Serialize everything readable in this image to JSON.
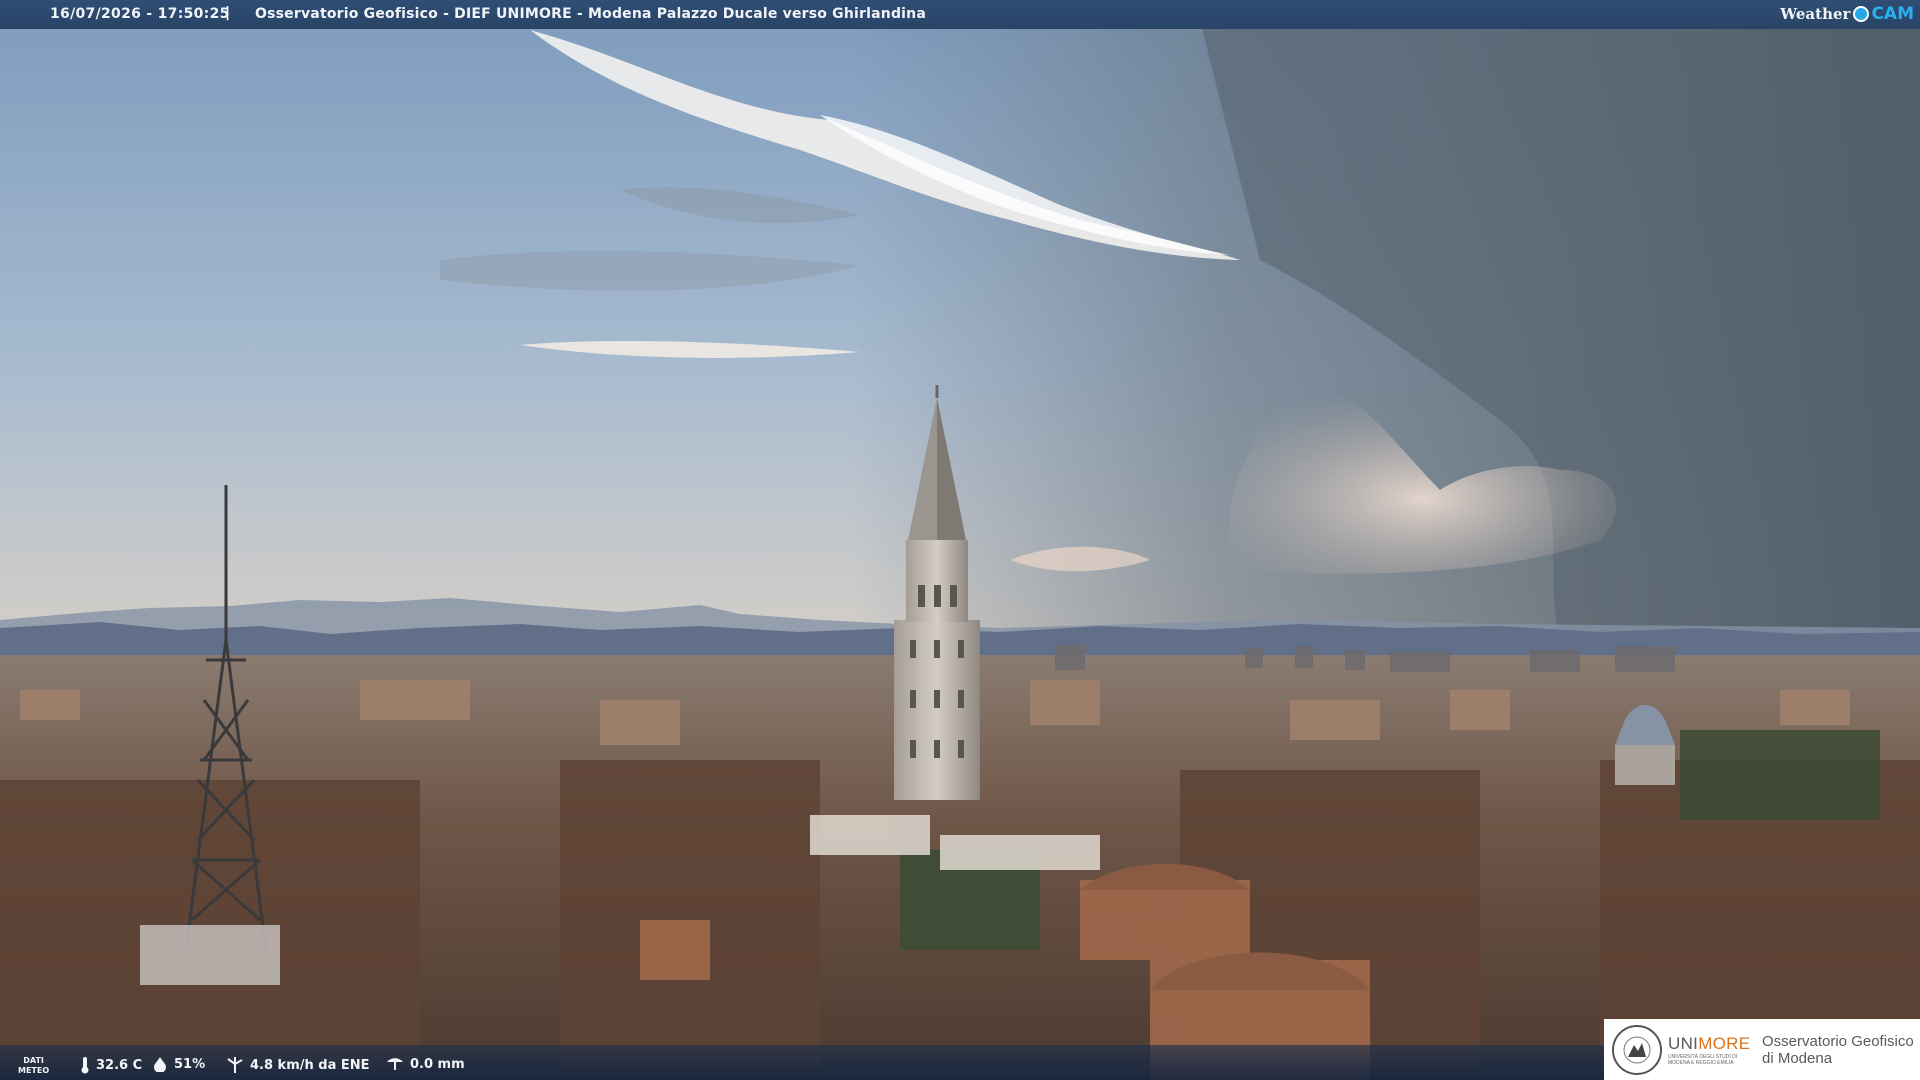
{
  "header": {
    "timestamp": "16/07/2026 - 17:50:25",
    "separator": "|",
    "title": "Osservatorio Geofisico - DIEF UNIMORE - Modena Palazzo Ducale verso Ghirlandina",
    "brand_weather": "Weather",
    "brand_cam": "CAM"
  },
  "footer": {
    "dati_line1": "DATI",
    "dati_line2": "METEO",
    "temperature": "32.6 C",
    "humidity": "51%",
    "wind": "4.8 km/h da ENE",
    "rain": "0.0 mm"
  },
  "logo": {
    "uni_prefix": "UNI",
    "uni_suffix": "MORE",
    "uni_sub1": "UNIVERSITÀ DEGLI STUDI DI",
    "uni_sub2": "MODENA E REGGIO EMILIA",
    "obs_line1": "Osservatorio Geofisico",
    "obs_line2": "di Modena"
  },
  "icons": [
    "thermometer-icon",
    "humidity-drop-icon",
    "wind-turbine-icon",
    "rain-gauge-icon",
    "weathercam-lens-icon",
    "university-seal-icon"
  ],
  "colors": {
    "bar": "#2b4569",
    "cam_blue": "#2ab0ee",
    "unimore_orange": "#d9731c"
  }
}
